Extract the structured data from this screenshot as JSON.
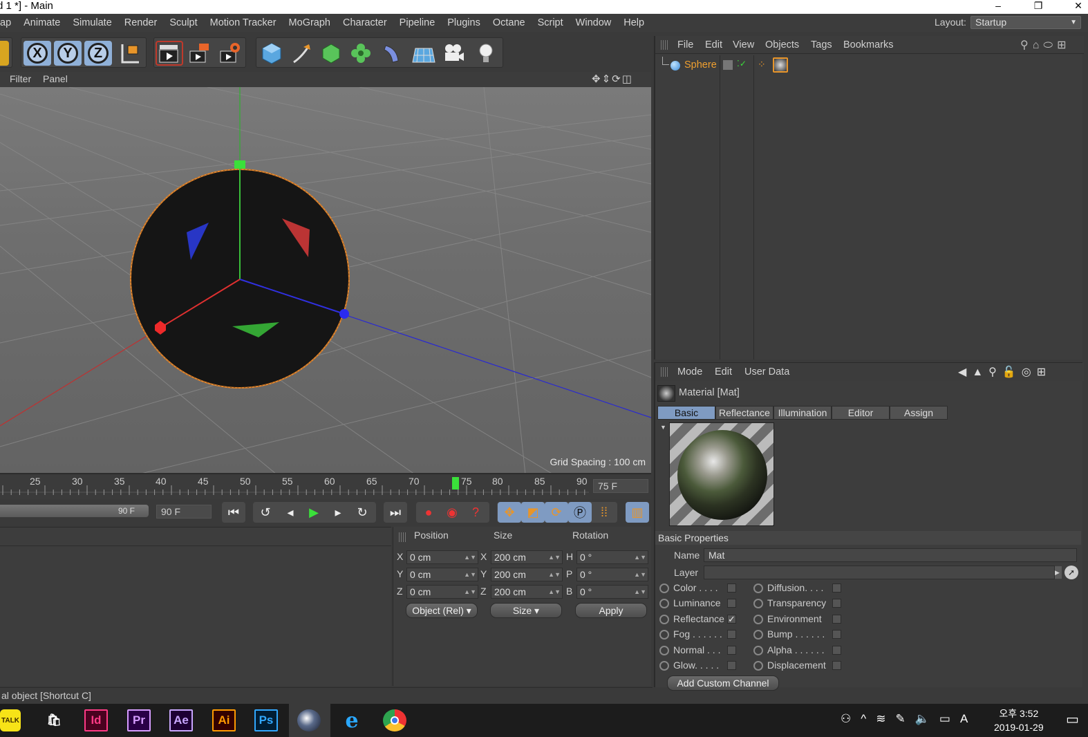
{
  "window": {
    "title": "d 1 *] - Main",
    "minimize": "–",
    "restore": "❐",
    "close": "✕"
  },
  "menu": [
    "ap",
    "Animate",
    "Simulate",
    "Render",
    "Sculpt",
    "Motion Tracker",
    "MoGraph",
    "Character",
    "Pipeline",
    "Plugins",
    "Octane",
    "Script",
    "Window",
    "Help"
  ],
  "layout": {
    "label": "Layout:",
    "value": "Startup"
  },
  "toolbar": {
    "axes": [
      "X",
      "Y",
      "Z"
    ]
  },
  "viewport": {
    "menu": [
      "Filter",
      "Panel"
    ],
    "grid_spacing": "Grid Spacing : 100 cm"
  },
  "timeline": {
    "ticks": [
      "25",
      "30",
      "35",
      "40",
      "45",
      "50",
      "55",
      "60",
      "65",
      "70",
      "75",
      "80",
      "85",
      "90"
    ],
    "current_frame": "75 F",
    "range_end_label": "90 F",
    "end_field": "90 F"
  },
  "coords": {
    "headers": [
      "Position",
      "Size",
      "Rotation"
    ],
    "rows": [
      {
        "axis": "X",
        "pos": "0 cm",
        "saxis": "X",
        "size": "200 cm",
        "raxis": "H",
        "rot": "0 °"
      },
      {
        "axis": "Y",
        "pos": "0 cm",
        "saxis": "Y",
        "size": "200 cm",
        "raxis": "P",
        "rot": "0 °"
      },
      {
        "axis": "Z",
        "pos": "0 cm",
        "saxis": "Z",
        "size": "200 cm",
        "raxis": "B",
        "rot": "0 °"
      }
    ],
    "mode": "Object (Rel)",
    "size_mode": "Size",
    "apply": "Apply"
  },
  "status": "al object [Shortcut C]",
  "object_manager": {
    "menu": [
      "File",
      "Edit",
      "View",
      "Objects",
      "Tags",
      "Bookmarks"
    ],
    "object_name": "Sphere"
  },
  "attributes": {
    "menu": [
      "Mode",
      "Edit",
      "User Data"
    ],
    "title": "Material [Mat]",
    "tabs": [
      "Basic",
      "Reflectance",
      "Illumination",
      "Editor",
      "Assign"
    ],
    "section": "Basic Properties",
    "name_label": "Name",
    "name_value": "Mat",
    "layer_label": "Layer",
    "channels_left": [
      {
        "label": "Color . . . .",
        "checked": false
      },
      {
        "label": "Luminance",
        "checked": false
      },
      {
        "label": "Reflectance",
        "checked": true
      },
      {
        "label": "Fog . . . . . .",
        "checked": false
      },
      {
        "label": "Normal . . .",
        "checked": false
      },
      {
        "label": "Glow. . . . .",
        "checked": false
      }
    ],
    "channels_right": [
      {
        "label": "Diffusion. . . .",
        "checked": false
      },
      {
        "label": "Transparency",
        "checked": false
      },
      {
        "label": "Environment",
        "checked": false
      },
      {
        "label": "Bump . . . . . .",
        "checked": false
      },
      {
        "label": "Alpha . . . . . .",
        "checked": false
      },
      {
        "label": "Displacement",
        "checked": false
      }
    ],
    "add_channel": "Add Custom Channel",
    "check_mark": "✓"
  },
  "taskbar": {
    "apps": [
      {
        "name": "TALK",
        "color": "#f7e317",
        "fg": "#3b2a00"
      },
      {
        "name": "🛍",
        "color": "#1c1c1c",
        "fg": "#fff"
      },
      {
        "name": "Id",
        "color": "#49021f",
        "fg": "#ff3a85"
      },
      {
        "name": "Pr",
        "color": "#2a0047",
        "fg": "#d69cff"
      },
      {
        "name": "Ae",
        "color": "#1d0033",
        "fg": "#c9a6ff"
      },
      {
        "name": "Ai",
        "color": "#330000",
        "fg": "#ff9a00"
      },
      {
        "name": "Ps",
        "color": "#001d34",
        "fg": "#31a8ff"
      }
    ],
    "time": "오후 3:52",
    "date": "2019-01-29",
    "ime": "A"
  }
}
